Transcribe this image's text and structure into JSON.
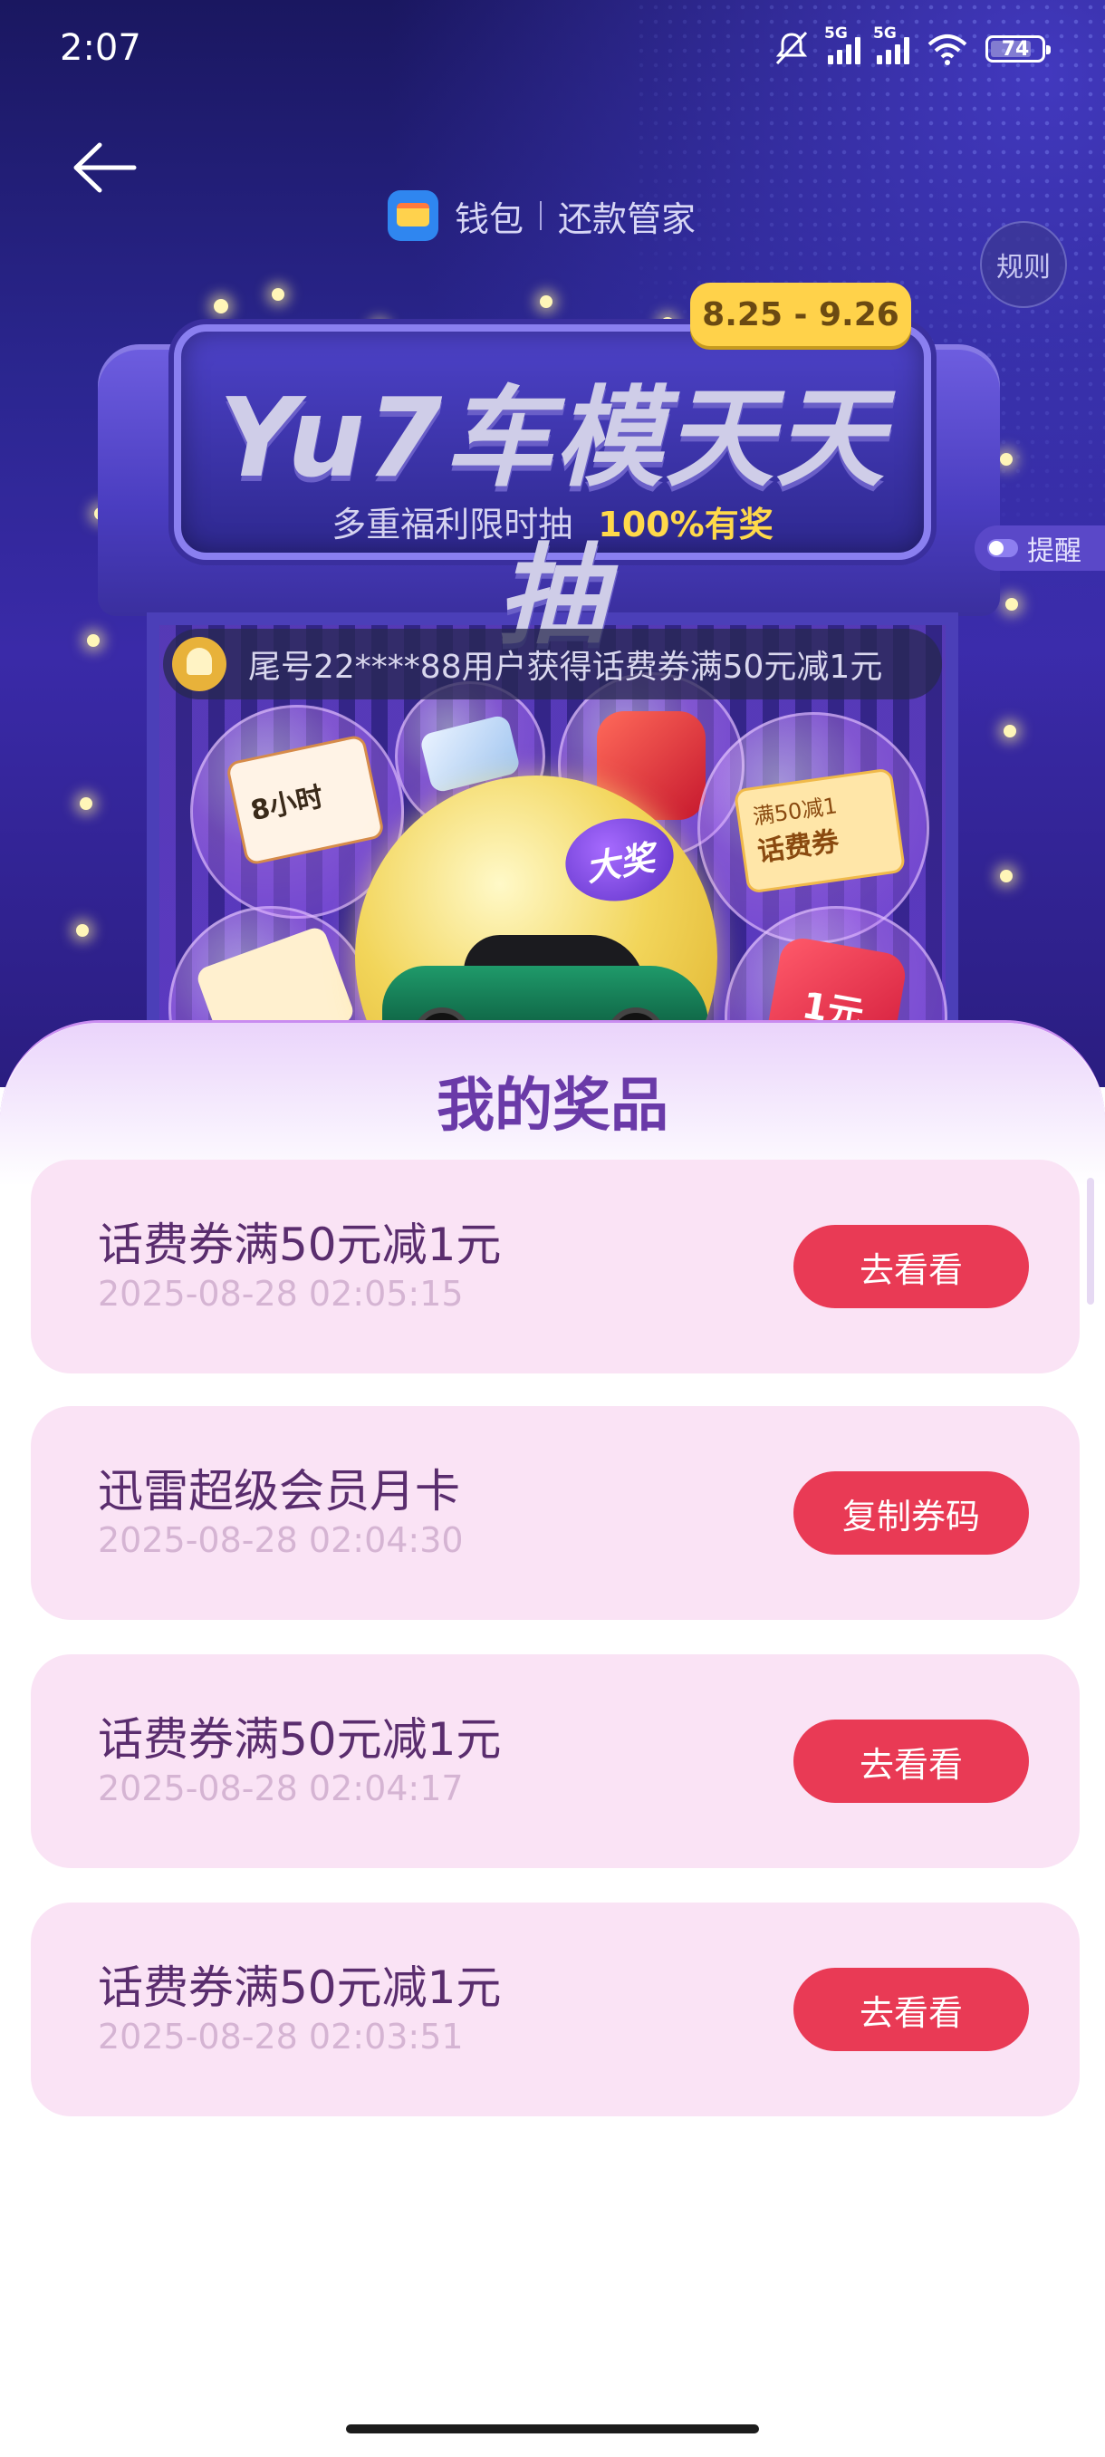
{
  "status_bar": {
    "time": "2:07",
    "network_1": "5G",
    "network_2": "5G",
    "battery": "74"
  },
  "header": {
    "crumb_wallet": "钱包",
    "crumb_page": "还款管家",
    "rules_label": "规则"
  },
  "banner": {
    "title": "Yu7车模天天抽",
    "subtitle": "多重福利限时抽",
    "subtitle_highlight": "100%有奖",
    "date_range": "8.25 - 9.26",
    "remind_label": "提醒"
  },
  "ticker": {
    "text": "尾号22****88用户获得话费券满50元减1元"
  },
  "machine": {
    "prize_hours": "8小时",
    "prize_coupon_line1": "满50减1",
    "prize_coupon_line2": "话费券",
    "big_tag": "大奖",
    "prize_yuan": "1元"
  },
  "sheet": {
    "title": "我的奖品",
    "prizes": [
      {
        "name": "话费券满50元减1元",
        "time": "2025-08-28 02:05:15",
        "action": "去看看"
      },
      {
        "name": "迅雷超级会员月卡",
        "time": "2025-08-28 02:04:30",
        "action": "复制券码"
      },
      {
        "name": "话费券满50元减1元",
        "time": "2025-08-28 02:04:17",
        "action": "去看看"
      },
      {
        "name": "话费券满50元减1元",
        "time": "2025-08-28 02:03:51",
        "action": "去看看"
      }
    ]
  },
  "colors": {
    "accent_button": "#e93a55",
    "title_purple": "#6a3aa8",
    "card_bg": "#fae3f5",
    "badge_yellow": "#ffd24a"
  },
  "icons": [
    "back-arrow-icon",
    "wallet-icon",
    "mute-icon",
    "signal-icon",
    "wifi-icon",
    "battery-icon",
    "bell-icon"
  ]
}
